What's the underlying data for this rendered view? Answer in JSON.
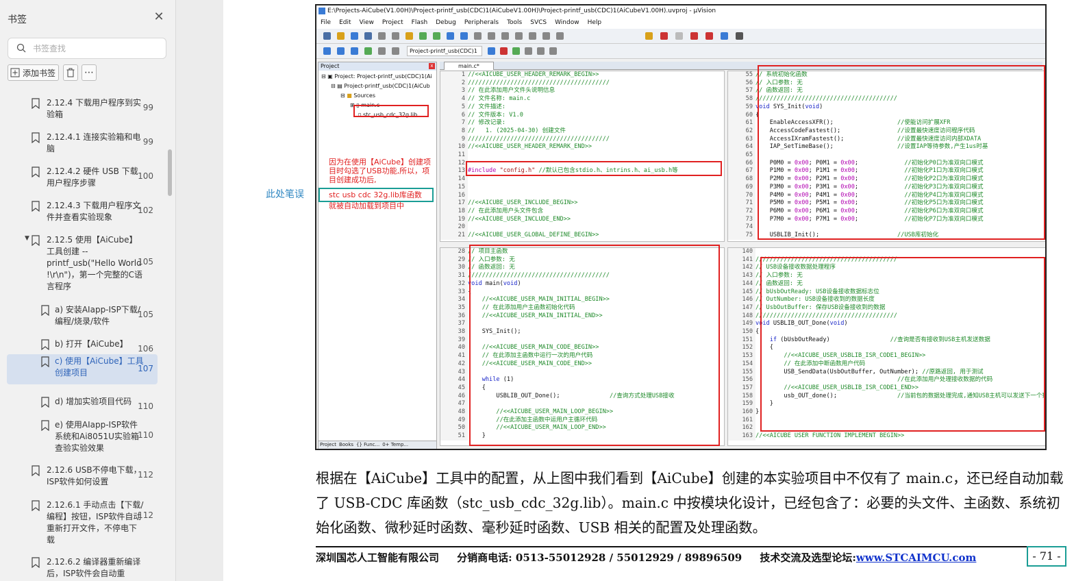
{
  "sidebar": {
    "title": "书签",
    "search_placeholder": "书签查找",
    "add_label": "添加书签",
    "items": [
      {
        "label": "2.12.4 下载用户程序到实验箱",
        "page": "99"
      },
      {
        "label": "2.12.4.1 连接实验箱和电脑",
        "page": "99"
      },
      {
        "label": "2.12.4.2 硬件 USB 下载用户程序步骤",
        "page": "100"
      },
      {
        "label": "2.12.4.3 下载用户程序文件并查看实验现象",
        "page": "102"
      },
      {
        "label": "2.12.5 使用【AiCube】工具创建 -- printf_usb(\"Hello World !\\r\\n\")，第一个完整的C语言程序",
        "page": "105"
      },
      {
        "label": "a) 安装AIapp-ISP下载/编程/烧录/软件",
        "page": "105"
      },
      {
        "label": "b) 打开【AiCube】",
        "page": "106"
      },
      {
        "label": "c) 使用【AiCube】工具创建项目",
        "page": "107"
      },
      {
        "label": "d) 增加实验项目代码",
        "page": "110"
      },
      {
        "label": "e) 使用AIapp-ISP软件系统和Ai8051U实验箱查验实验效果",
        "page": "110"
      },
      {
        "label": "2.12.6 USB不停电下载，ISP软件如何设置",
        "page": "112"
      },
      {
        "label": "2.12.6.1 手动点击【下载/编程】按钮，ISP软件自动重新打开文件，不停电下载",
        "page": "112"
      },
      {
        "label": "2.12.6.2 编译器重新编译后，ISP软件会自动重",
        "page": ""
      }
    ]
  },
  "doc": {
    "side_note": "此处笔误",
    "window_title": "E:\\Projects-AiCube(V1.00H)\\Project-printf_usb(CDC)1(AiCubeV1.00H)\\Project-printf_usb(CDC)1(AiCubeV1.00H).uvproj - µVision",
    "menu": [
      "File",
      "Edit",
      "View",
      "Project",
      "Flash",
      "Debug",
      "Peripherals",
      "Tools",
      "SVCS",
      "Window",
      "Help"
    ],
    "target_combo": "Project-printf_usb(CDC)1",
    "project_panel_title": "Project",
    "tree": [
      "Project: Project-printf_usb(CDC)1(Ai",
      "Project-printf_usb(CDC)1(AiCub",
      "Sources",
      "main.c",
      "stc_usb_cdc_32g.lib"
    ],
    "proj_tabs": [
      "Project",
      "Books",
      "{} Func...",
      "0+ Temp..."
    ],
    "editor_tab": "main.c*",
    "annotation_red": "因为在使用【AiCube】创建项目时勾选了USB功能,所以，项目创建成功后,",
    "annotation_teal": "stc usb cdc 32g.lib库函数",
    "annotation_red2": "就被自动加载到项目中",
    "label_sysinit": "系统初始化函数",
    "label_main": "项目主函数",
    "label_usb": "USB设备接收数据处理程序",
    "paragraph": "根据在【AiCube】工具中的配置，从上图中我们看到【AiCube】创建的本实验项目中不仅有了 main.c，还已经自动加载了 USB-CDC 库函数（stc_usb_cdc_32g.lib）。main.c 中按模块化设计，已经包含了：必要的头文件、主函数、系统初始化函数、微秒延时函数、毫秒延时函数、USB 相关的配置及处理函数。",
    "footer_company": "深圳国芯人工智能有限公司",
    "footer_phone": "分销商电话: 0513-55012928 / 55012929 / 89896509",
    "footer_forum": "技术交流及选型论坛:",
    "footer_url": "www.STCAIMCU.com",
    "page_number": "- 71 -"
  }
}
